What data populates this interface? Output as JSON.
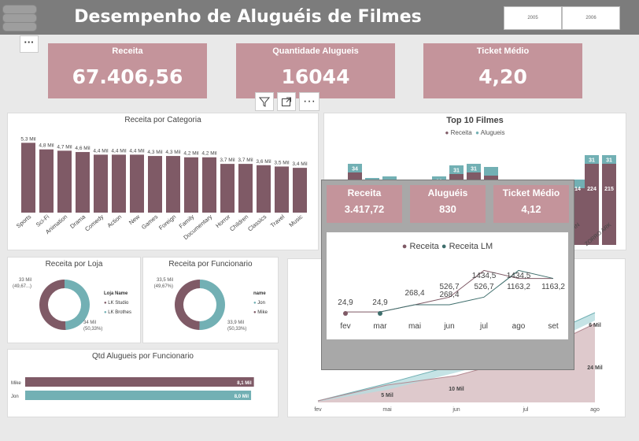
{
  "dashboard": {
    "title": "Desempenho de Aluguéis de Filmes",
    "year_slicer": [
      "2005",
      "2006"
    ],
    "more_label": "···"
  },
  "kpis": [
    {
      "label": "Receita",
      "value": "67.406,56"
    },
    {
      "label": "Quantidade Alugueis",
      "value": "16044"
    },
    {
      "label": "Ticket Médio",
      "value": "4,20"
    }
  ],
  "colors": {
    "mauve": "#7f5a66",
    "teal": "#72b0b4",
    "kpi": "#c4949b",
    "dark_teal": "#3e6e6c"
  },
  "visual_toolbar": {
    "icons": [
      "filter-icon",
      "focus-mode-icon",
      "more-options-icon"
    ]
  },
  "chart_data": [
    {
      "type": "bar",
      "title": "Receita por Categoria",
      "categories": [
        "Sports",
        "Sci-Fi",
        "Animation",
        "Drama",
        "Comedy",
        "Action",
        "New",
        "Games",
        "Foreign",
        "Family",
        "Documentary",
        "Horror",
        "Children",
        "Classics",
        "Travel",
        "Music"
      ],
      "values": [
        5.3,
        4.8,
        4.7,
        4.6,
        4.4,
        4.4,
        4.4,
        4.3,
        4.3,
        4.2,
        4.2,
        3.7,
        3.7,
        3.6,
        3.5,
        3.4
      ],
      "data_labels": [
        "5,3 Mil",
        "4,8 Mil",
        "4,7 Mil",
        "4,6 Mil",
        "4,4 Mil",
        "4,4 Mil",
        "4,4 Mil",
        "4,3 Mil",
        "4,3 Mil",
        "4,2 Mil",
        "4,2 Mil",
        "3,7 Mil",
        "3,7 Mil",
        "3,6 Mil",
        "3,5 Mil",
        "3,4 Mil"
      ],
      "unit": "Mil",
      "ylim": [
        0,
        5.5
      ]
    },
    {
      "type": "bar",
      "title": "Top 10 Filmes",
      "legend": [
        "Receita",
        "Alugueis"
      ],
      "legend_placement": "top-center",
      "visible_bars": [
        {
          "label": "",
          "alugueis": 34
        },
        {
          "label": "",
          "alugueis": null
        },
        {
          "label": "",
          "alugueis": null
        },
        {
          "label": "",
          "alugueis": null
        },
        {
          "label": "",
          "alugueis": 32
        },
        {
          "label": "",
          "alugueis": 31
        },
        {
          "label": "",
          "alugueis": 31
        },
        {
          "label": "",
          "alugueis": null
        },
        {
          "label": "TURN",
          "alugueis": null,
          "receita": "14"
        },
        {
          "label": "",
          "alugueis": 31,
          "receita": "224"
        },
        {
          "label": "ZORRO ARK",
          "alugueis": 31,
          "receita": "215"
        }
      ]
    },
    {
      "type": "pie",
      "title": "Receita por Loja",
      "legend_title": "Loja Name",
      "series": [
        {
          "name": "LK Studio",
          "value": 33,
          "label": "33 Mil\n(49,67...)"
        },
        {
          "name": "LK Brothes",
          "value": 34,
          "label": "34 Mil\n(50,33%)"
        }
      ]
    },
    {
      "type": "pie",
      "title": "Receita por Funcionario",
      "legend_title": "name",
      "series": [
        {
          "name": "Jon",
          "value": 33.9,
          "label": "33,9 Mil\n(50,33%)"
        },
        {
          "name": "Mike",
          "value": 33.5,
          "label": "33,5 Mil\n(49,67%)"
        }
      ]
    },
    {
      "type": "bar",
      "title": "Qtd Alugueis por Funcionario",
      "categories": [
        "Mike",
        "Jon"
      ],
      "values": [
        8.1,
        8.0
      ],
      "data_labels": [
        "8,1 Mil",
        "8,0 Mil"
      ],
      "xlim": [
        0,
        8.5
      ]
    },
    {
      "type": "area",
      "categories": [
        "fev",
        "mai",
        "jun",
        "jul",
        "ago"
      ],
      "data_labels": [
        "5 Mil",
        "10 Mil",
        "24 Mil",
        "6 Mil"
      ]
    },
    {
      "type": "line",
      "legend": [
        "Receita",
        "Receita LM"
      ],
      "categories": [
        "fev",
        "mar",
        "mai",
        "jun",
        "jul",
        "ago",
        "set"
      ],
      "series": [
        {
          "name": "Receita",
          "values": [
            24.9,
            24.9,
            268.4,
            526.7,
            1434.5,
            1163.2,
            1163.2
          ]
        },
        {
          "name": "Receita LM",
          "values": [
            null,
            24.9,
            268.4,
            268.4,
            526.7,
            1434.5,
            1163.2
          ]
        }
      ],
      "point_labels": [
        {
          "x": "fev",
          "text": "24,9"
        },
        {
          "x": "mar",
          "text": "24,9"
        },
        {
          "x": "mai",
          "text": "268,4"
        },
        {
          "x": "jun",
          "text": "526,7"
        },
        {
          "x": "jun",
          "text": "268,4"
        },
        {
          "x": "jul",
          "text": "1434,5"
        },
        {
          "x": "jul",
          "text": "526,7"
        },
        {
          "x": "ago",
          "text": "1434,5"
        },
        {
          "x": "ago",
          "text": "1163,2"
        },
        {
          "x": "set",
          "text": "1163,2"
        }
      ]
    }
  ],
  "tooltip": {
    "kpis": [
      {
        "label": "Receita",
        "value": "3.417,72"
      },
      {
        "label": "Aluguéis",
        "value": "830"
      },
      {
        "label": "Ticket Médio",
        "value": "4,12"
      }
    ]
  }
}
